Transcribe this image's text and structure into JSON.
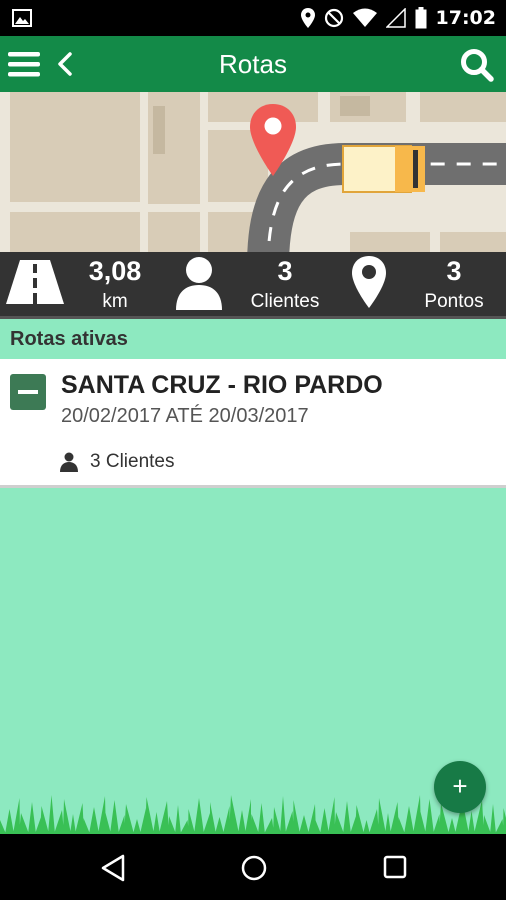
{
  "status_bar": {
    "time": "17:02"
  },
  "app_bar": {
    "title": "Rotas"
  },
  "stats": {
    "distance_value": "3,08",
    "distance_unit": "km",
    "clients_value": "3",
    "clients_label": "Clientes",
    "points_value": "3",
    "points_label": "Pontos"
  },
  "section": {
    "title": "Rotas ativas"
  },
  "routes": [
    {
      "name": "SANTA CRUZ - RIO PARDO",
      "dates": "20/02/2017 ATÉ 20/03/2017",
      "clients": "3 Clientes"
    }
  ],
  "fab": {
    "label": "+"
  },
  "colors": {
    "primary": "#138a48",
    "accent_bg": "#8de9c0",
    "stats_bg": "#333333",
    "marker": "#f05a55",
    "truck": "#f7b84b"
  }
}
